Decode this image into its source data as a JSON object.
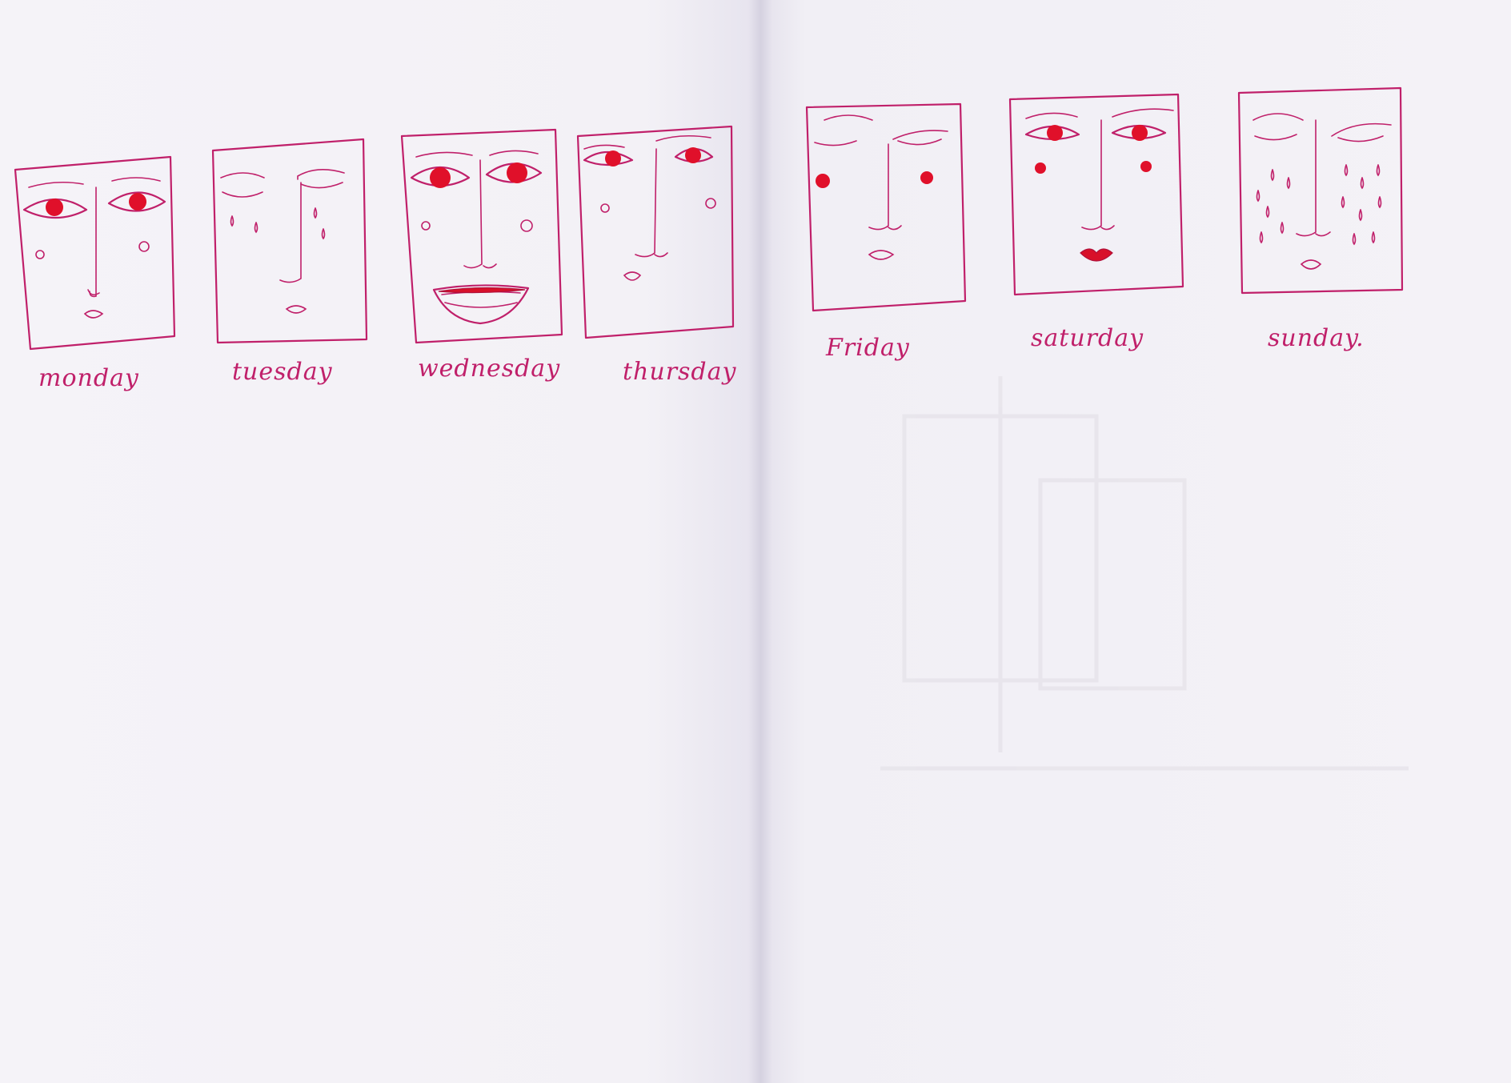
{
  "days": [
    {
      "label": "monday"
    },
    {
      "label": "tuesday"
    },
    {
      "label": "wednesday"
    },
    {
      "label": "thursday"
    },
    {
      "label": "Friday"
    },
    {
      "label": "saturday"
    },
    {
      "label": "sunday."
    }
  ],
  "colors": {
    "ink": "#c0206a",
    "accent_red": "#e0102a",
    "paper": "#f3f1f6"
  }
}
